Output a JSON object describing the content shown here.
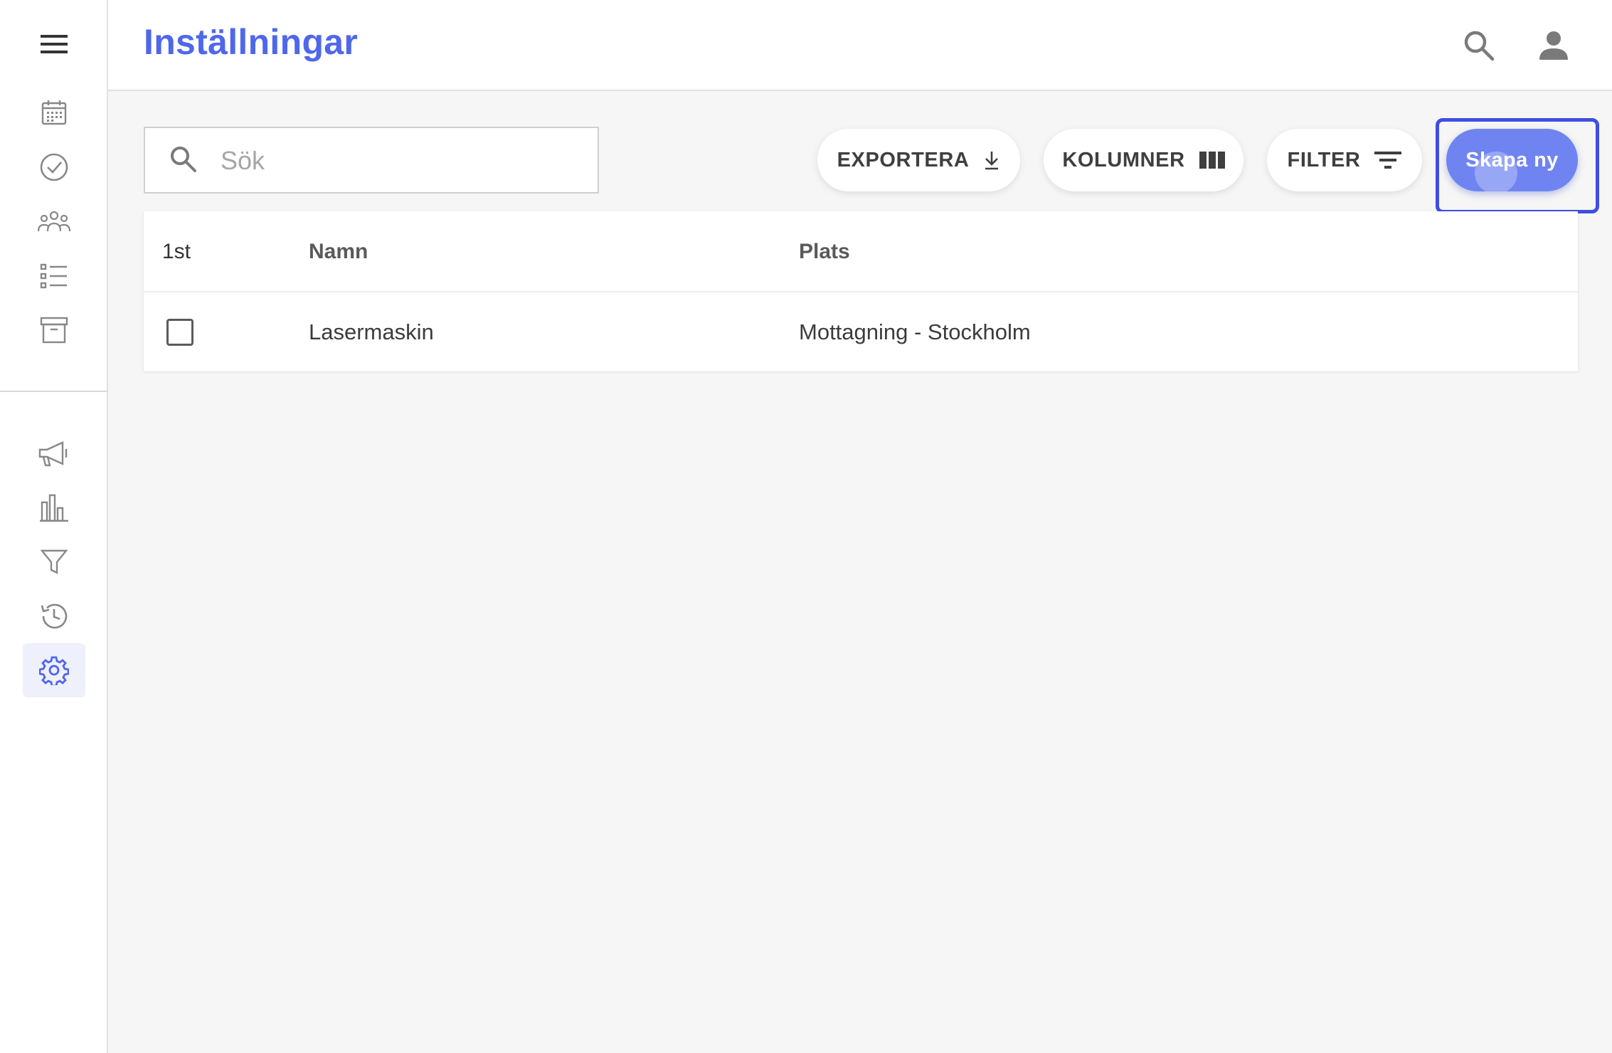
{
  "header": {
    "title": "Inställningar"
  },
  "sidebar": {
    "top_items": [
      {
        "icon": "calendar-icon"
      },
      {
        "icon": "check-circle-icon"
      },
      {
        "icon": "group-icon"
      },
      {
        "icon": "list-icon"
      },
      {
        "icon": "archive-icon"
      }
    ],
    "bottom_items": [
      {
        "icon": "megaphone-icon"
      },
      {
        "icon": "bar-chart-icon"
      },
      {
        "icon": "funnel-icon"
      },
      {
        "icon": "history-icon"
      },
      {
        "icon": "settings-icon",
        "active": true
      }
    ]
  },
  "toolbar": {
    "search_placeholder": "Sök",
    "export_label": "EXPORTERA",
    "columns_label": "KOLUMNER",
    "filter_label": "FILTER",
    "create_label": "Skapa ny"
  },
  "table": {
    "count_label": "1st",
    "columns": [
      "Namn",
      "Plats"
    ],
    "rows": [
      {
        "name": "Lasermaskin",
        "place": "Mottagning - Stockholm"
      }
    ]
  },
  "colors": {
    "accent": "#4f67ea",
    "create_button": "#6f84f1",
    "focus_ring": "#3e4fe0"
  }
}
